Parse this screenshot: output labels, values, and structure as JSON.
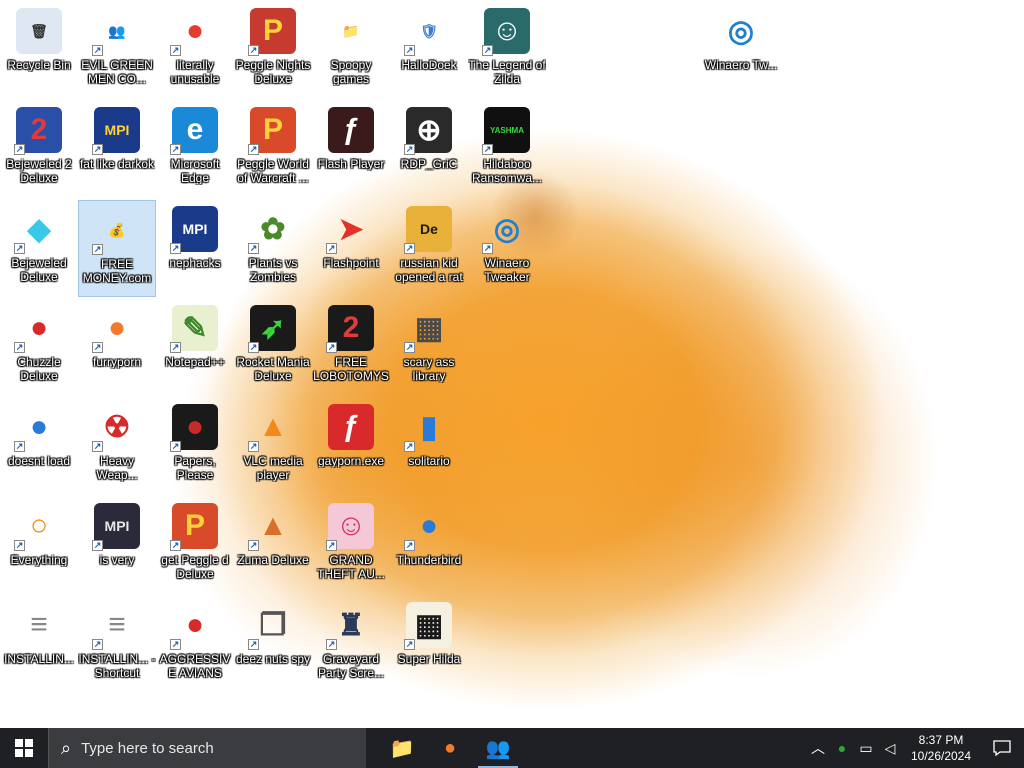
{
  "desktop": {
    "icons": [
      {
        "label": "Recycle Bin",
        "icon": "recycle-bin-icon",
        "glyph": "🗑",
        "bg": "#dfe8f2",
        "fg": "#333",
        "shortcut": false
      },
      {
        "label": "EVIL GREEN MEN CO...",
        "icon": "green-men-icon",
        "glyph": "👥",
        "bg": "transparent",
        "fg": "#2fa83a",
        "shortcut": true
      },
      {
        "label": "literally unusable",
        "icon": "chrome-icon",
        "glyph": "●",
        "bg": "transparent",
        "fg": "#e53b2f",
        "shortcut": true
      },
      {
        "label": "Peggle Nights Deluxe",
        "icon": "peggle-nights-icon",
        "glyph": "P",
        "bg": "#c63a2f",
        "fg": "#ffd23a",
        "shortcut": true
      },
      {
        "label": "Spoopy games",
        "icon": "folder-icon",
        "glyph": "📁",
        "bg": "transparent",
        "fg": "#e2a23a",
        "shortcut": false
      },
      {
        "label": "HalloDoek",
        "icon": "windows-shield-icon",
        "glyph": "🛡",
        "bg": "transparent",
        "fg": "#3a7bd5",
        "shortcut": true
      },
      {
        "label": "The Legend of Zilda",
        "icon": "zilda-icon",
        "glyph": "☺",
        "bg": "#2a6a6a",
        "fg": "#ffffff",
        "shortcut": true
      },
      {
        "label": "Winaero Tw...",
        "icon": "winaero-setup-icon",
        "glyph": "◎",
        "bg": "transparent",
        "fg": "#1f7fd0",
        "shortcut": false
      },
      {
        "label": "Bejeweled 2 Deluxe",
        "icon": "bejeweled2-icon",
        "glyph": "2",
        "bg": "#2a4fa8",
        "fg": "#e23a3a",
        "shortcut": true
      },
      {
        "label": "fat like darkok",
        "icon": "mpi-icon",
        "glyph": "MPI",
        "bg": "#1a3a8a",
        "fg": "#ffd23a",
        "shortcut": true
      },
      {
        "label": "Microsoft Edge",
        "icon": "edge-icon",
        "glyph": "e",
        "bg": "#1a8ad8",
        "fg": "#ffffff",
        "shortcut": true
      },
      {
        "label": "Peggle World of Warcraft ...",
        "icon": "peggle-wow-icon",
        "glyph": "P",
        "bg": "#d84a2a",
        "fg": "#ffd23a",
        "shortcut": true
      },
      {
        "label": "Flash Player",
        "icon": "flash-icon",
        "glyph": "ƒ",
        "bg": "#3a1a1a",
        "fg": "#ffffff",
        "shortcut": false
      },
      {
        "label": "RDP_GriC",
        "icon": "rdp-icon",
        "glyph": "⊕",
        "bg": "#2a2a2a",
        "fg": "#ffffff",
        "shortcut": true
      },
      {
        "label": "Hildaboo Ransomwa...",
        "icon": "yashma-icon",
        "glyph": "YASHMA",
        "bg": "#101010",
        "fg": "#3ad83a",
        "shortcut": true
      },
      {
        "label": "Bejeweled Deluxe",
        "icon": "diamond-icon",
        "glyph": "◆",
        "bg": "transparent",
        "fg": "#3ac8e8",
        "shortcut": true
      },
      {
        "label": "FREE MONEY.com",
        "icon": "money-bag-icon",
        "glyph": "💰",
        "bg": "transparent",
        "fg": "#8a6a2a",
        "shortcut": true
      },
      {
        "label": "nephacks",
        "icon": "mpi-icon",
        "glyph": "MPI",
        "bg": "#1a3a8a",
        "fg": "#ffffff",
        "shortcut": true
      },
      {
        "label": "Plants vs Zombies",
        "icon": "plants-icon",
        "glyph": "✿",
        "bg": "transparent",
        "fg": "#4a8a2a",
        "shortcut": true
      },
      {
        "label": "Flashpoint",
        "icon": "flashpoint-icon",
        "glyph": "➤",
        "bg": "transparent",
        "fg": "#e2302a",
        "shortcut": true
      },
      {
        "label": "russian kid opened a rat",
        "icon": "de-icon",
        "glyph": "De",
        "bg": "#e8b23a",
        "fg": "#1a1a1a",
        "shortcut": true
      },
      {
        "label": "Winaero Tweaker",
        "icon": "winaero-icon",
        "glyph": "◎",
        "bg": "transparent",
        "fg": "#1f7fd0",
        "shortcut": true
      },
      {
        "label": "Chuzzle Deluxe",
        "icon": "chuzzle-icon",
        "glyph": "●",
        "bg": "transparent",
        "fg": "#d82a2a",
        "shortcut": true
      },
      {
        "label": "furryporn",
        "icon": "firefox-icon",
        "glyph": "●",
        "bg": "transparent",
        "fg": "#f27a2a",
        "shortcut": true
      },
      {
        "label": "Notepad++",
        "icon": "notepadpp-icon",
        "glyph": "✎",
        "bg": "#e8f0d0",
        "fg": "#3a8a2a",
        "shortcut": true
      },
      {
        "label": "Rocket Mania Deluxe",
        "icon": "rocket-icon",
        "glyph": "➶",
        "bg": "#1a1a1a",
        "fg": "#3ad83a",
        "shortcut": true
      },
      {
        "label": "FREE LOBOTOMYS",
        "icon": "lobotomy-icon",
        "glyph": "2",
        "bg": "#1a1a1a",
        "fg": "#e23a3a",
        "shortcut": true
      },
      {
        "label": "scary ass library",
        "icon": "library-icon",
        "glyph": "▦",
        "bg": "transparent",
        "fg": "#4a4a4a",
        "shortcut": true
      },
      {
        "label": "doesnt load",
        "icon": "thunderbird-icon",
        "glyph": "●",
        "bg": "transparent",
        "fg": "#2a7ad8",
        "shortcut": true
      },
      {
        "label": "Heavy Weap...",
        "icon": "radiation-icon",
        "glyph": "☢",
        "bg": "transparent",
        "fg": "#d82a2a",
        "shortcut": true
      },
      {
        "label": "Papers, Please",
        "icon": "papers-icon",
        "glyph": "●",
        "bg": "#1a1a1a",
        "fg": "#c82a2a",
        "shortcut": true
      },
      {
        "label": "VLC media player",
        "icon": "vlc-icon",
        "glyph": "▲",
        "bg": "transparent",
        "fg": "#f28a1a",
        "shortcut": true
      },
      {
        "label": "gayporn.exe",
        "icon": "flash-icon",
        "glyph": "ƒ",
        "bg": "#d82a2a",
        "fg": "#ffffff",
        "shortcut": false
      },
      {
        "label": "solitario",
        "icon": "solitaire-icon",
        "glyph": "▮",
        "bg": "transparent",
        "fg": "#2a7ad8",
        "shortcut": true
      },
      {
        "label": "Everything",
        "icon": "everything-search-icon",
        "glyph": "○",
        "bg": "transparent",
        "fg": "#f28a1a",
        "shortcut": true
      },
      {
        "label": "is very",
        "icon": "mpi-shield-icon",
        "glyph": "MPI",
        "bg": "#2a2a3a",
        "fg": "#e8e8e8",
        "shortcut": true
      },
      {
        "label": "get Peggle d Deluxe",
        "icon": "peggle-icon",
        "glyph": "P",
        "bg": "#d84a2a",
        "fg": "#ffd23a",
        "shortcut": true
      },
      {
        "label": "Zuma Deluxe",
        "icon": "zuma-icon",
        "glyph": "▲",
        "bg": "transparent",
        "fg": "#d8702a",
        "shortcut": true
      },
      {
        "label": "GRAND THEFT AU...",
        "icon": "anime-girl-icon",
        "glyph": "☺",
        "bg": "#f5c8d8",
        "fg": "#d82a6a",
        "shortcut": true
      },
      {
        "label": "Thunderbird",
        "icon": "thunderbird-icon",
        "glyph": "●",
        "bg": "transparent",
        "fg": "#2a7ad8",
        "shortcut": true
      },
      {
        "label": "INSTALLIN...",
        "icon": "text-file-icon",
        "glyph": "≡",
        "bg": "#ffffff",
        "fg": "#888",
        "shortcut": false
      },
      {
        "label": "INSTALLIN... - Shortcut",
        "icon": "text-file-icon",
        "glyph": "≡",
        "bg": "#ffffff",
        "fg": "#888",
        "shortcut": true
      },
      {
        "label": "AGGRESSIVE AVIANS",
        "icon": "angry-bird-icon",
        "glyph": "●",
        "bg": "transparent",
        "fg": "#d82a2a",
        "shortcut": true
      },
      {
        "label": "deez nuts spy",
        "icon": "window-stack-icon",
        "glyph": "❐",
        "bg": "transparent",
        "fg": "#555",
        "shortcut": true
      },
      {
        "label": "Graveyard Party Scre...",
        "icon": "graveyard-icon",
        "glyph": "♜",
        "bg": "transparent",
        "fg": "#2a3a5a",
        "shortcut": true
      },
      {
        "label": "Super Hilda",
        "icon": "hilda-icon",
        "glyph": "▦",
        "bg": "#f5f0e0",
        "fg": "#1a1a1a",
        "shortcut": true
      }
    ]
  },
  "taskbar": {
    "search_placeholder": "Type here to search",
    "apps": [
      {
        "name": "file-explorer",
        "icon": "folder-icon",
        "glyph": "📁",
        "color": "#e8b23a",
        "active": false
      },
      {
        "name": "firefox",
        "icon": "firefox-icon",
        "glyph": "●",
        "color": "#f27a2a",
        "active": false
      },
      {
        "name": "green-men",
        "icon": "green-men-icon",
        "glyph": "👥",
        "color": "#2fa83a",
        "active": true
      }
    ],
    "clock_time": "8:37 PM",
    "clock_date": "10/26/2024"
  }
}
